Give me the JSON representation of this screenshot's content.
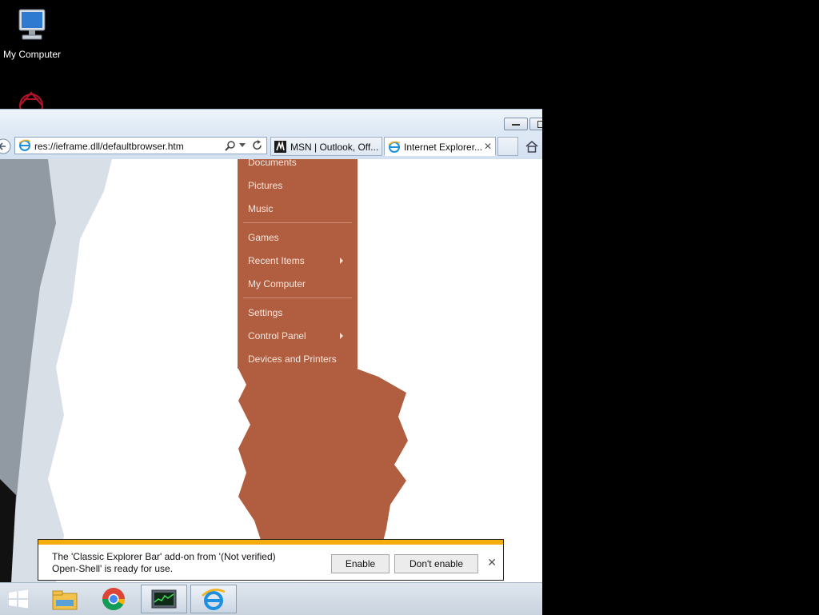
{
  "desktop": {
    "icons": [
      {
        "label": "My Computer",
        "icon": "my-computer-icon"
      },
      {
        "label": "",
        "icon": "decorative-logo-icon"
      }
    ]
  },
  "browser": {
    "address": "res://ieframe.dll/defaultbrowser.htm",
    "tabs": [
      {
        "title": "MSN | Outlook, Off...",
        "icon": "msn-icon",
        "active": false
      },
      {
        "title": "Internet Explorer...",
        "icon": "ie-icon",
        "active": true
      }
    ]
  },
  "start_menu": {
    "items": [
      {
        "label": "Documents",
        "has_submenu": false
      },
      {
        "label": "Pictures",
        "has_submenu": false
      },
      {
        "label": "Music",
        "has_submenu": false
      },
      {
        "label": "Games",
        "has_submenu": false
      },
      {
        "label": "Recent Items",
        "has_submenu": true
      },
      {
        "label": "My Computer",
        "has_submenu": false
      },
      {
        "label": "Settings",
        "has_submenu": false
      },
      {
        "label": "Control Panel",
        "has_submenu": true
      },
      {
        "label": "Devices and Printers",
        "has_submenu": false
      }
    ],
    "accent": "#b05e3f"
  },
  "notification": {
    "line1": "The 'Classic Explorer Bar' add-on from '(Not verified)",
    "line2": "Open-Shell' is ready for use.",
    "enable_label": "Enable",
    "dont_enable_label": "Don't enable",
    "close_glyph": "✕",
    "stripe_color": "#f4ad0c"
  },
  "taskbar": {
    "items": [
      {
        "icon": "start-icon",
        "active": false
      },
      {
        "icon": "file-explorer-icon",
        "active": false
      },
      {
        "icon": "chrome-icon",
        "active": false
      },
      {
        "icon": "task-manager-icon",
        "active": true
      },
      {
        "icon": "internet-explorer-icon",
        "active": true
      }
    ]
  }
}
